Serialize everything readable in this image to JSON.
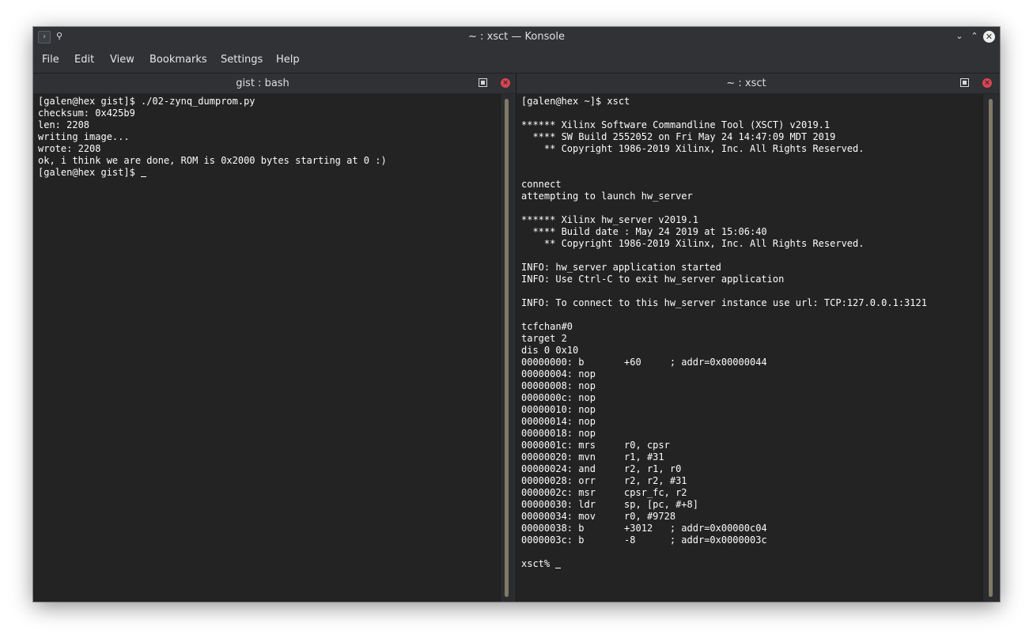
{
  "window": {
    "title": "~ : xsct — Konsole",
    "app_icon_glyph": "›",
    "pin_glyph": "📌",
    "minimize_glyph": "⌄",
    "maximize_glyph": "⌃",
    "close_glyph": "✕"
  },
  "menu": {
    "items": [
      "File",
      "Edit",
      "View",
      "Bookmarks",
      "Settings",
      "Help"
    ]
  },
  "left_pane": {
    "title": "gist : bash",
    "lines": [
      "[galen@hex gist]$ ./02-zynq_dumprom.py",
      "checksum: 0x425b9",
      "len: 2208",
      "writing image...",
      "wrote: 2208",
      "ok, i think we are done, ROM is 0x2000 bytes starting at 0 :)",
      "[galen@hex gist]$ "
    ]
  },
  "right_pane": {
    "title": "~ : xsct",
    "lines": [
      "[galen@hex ~]$ xsct",
      "",
      "****** Xilinx Software Commandline Tool (XSCT) v2019.1",
      "  **** SW Build 2552052 on Fri May 24 14:47:09 MDT 2019",
      "    ** Copyright 1986-2019 Xilinx, Inc. All Rights Reserved.",
      "",
      "",
      "connect",
      "attempting to launch hw_server",
      "",
      "****** Xilinx hw_server v2019.1",
      "  **** Build date : May 24 2019 at 15:06:40",
      "    ** Copyright 1986-2019 Xilinx, Inc. All Rights Reserved.",
      "",
      "INFO: hw_server application started",
      "INFO: Use Ctrl-C to exit hw_server application",
      "",
      "INFO: To connect to this hw_server instance use url: TCP:127.0.0.1:3121",
      "",
      "tcfchan#0",
      "target 2",
      "dis 0 0x10",
      "00000000: b       +60     ; addr=0x00000044",
      "00000004: nop",
      "00000008: nop",
      "0000000c: nop",
      "00000010: nop",
      "00000014: nop",
      "00000018: nop",
      "0000001c: mrs     r0, cpsr",
      "00000020: mvn     r1, #31",
      "00000024: and     r2, r1, r0",
      "00000028: orr     r2, r2, #31",
      "0000002c: msr     cpsr_fc, r2",
      "00000030: ldr     sp, [pc, #+8]",
      "00000034: mov     r0, #9728",
      "00000038: b       +3012   ; addr=0x00000c04",
      "0000003c: b       -8      ; addr=0x0000003c",
      "",
      "xsct% "
    ]
  },
  "colors": {
    "terminal_bg": "#232323",
    "terminal_fg": "#fcfcfc",
    "chrome_bg": "#303236",
    "close_red": "#da4453",
    "scroll_thumb": "#7f7967"
  }
}
